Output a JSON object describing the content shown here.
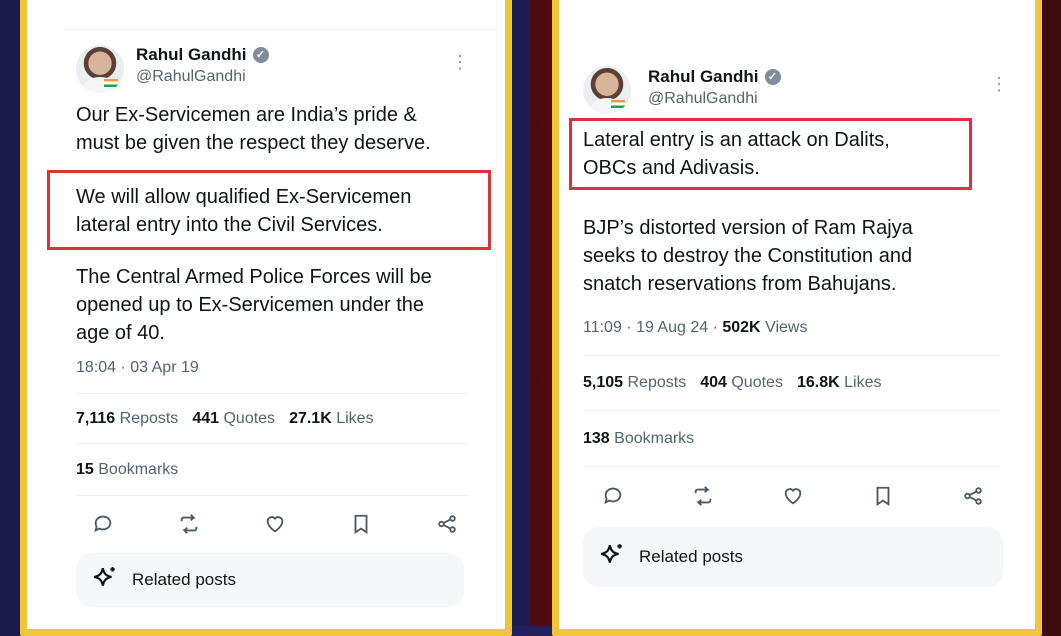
{
  "left_tweet": {
    "author_name": "Rahul Gandhi",
    "handle": "@RahulGandhi",
    "para1_line1": "Our Ex-Servicemen are India’s pride &",
    "para1_line2": "must be given the respect they deserve.",
    "highlight_line1": "We will allow qualified Ex-Servicemen",
    "highlight_line2": "lateral entry into the Civil Services.",
    "para3_line1": "The Central Armed Police Forces will be",
    "para3_line2": "opened up to Ex-Servicemen under the",
    "para3_line3": "age of 40.",
    "timestamp": "18:04 · 03 Apr 19",
    "reposts_count": "7,116",
    "reposts_label": "Reposts",
    "quotes_count": "441",
    "quotes_label": "Quotes",
    "likes_count": "27.1K",
    "likes_label": "Likes",
    "bookmarks_count": "15",
    "bookmarks_label": "Bookmarks",
    "related_label": "Related posts"
  },
  "right_tweet": {
    "author_name": "Rahul Gandhi",
    "handle": "@RahulGandhi",
    "highlight_line1": "Lateral entry is an attack on Dalits,",
    "highlight_line2": "OBCs and Adivasis.",
    "para2_line1": "BJP’s distorted version of Ram Rajya",
    "para2_line2": "seeks to destroy the Constitution and",
    "para2_line3": "snatch reservations from Bahujans.",
    "timestamp": "11:09 · 19 Aug 24 · ",
    "views_count": "502K",
    "views_label": "Views",
    "reposts_count": "5,105",
    "reposts_label": "Reposts",
    "quotes_count": "404",
    "quotes_label": "Quotes",
    "likes_count": "16.8K",
    "likes_label": "Likes",
    "bookmarks_count": "138",
    "bookmarks_label": "Bookmarks",
    "related_label": "Related posts"
  },
  "icons": [
    "reply-icon",
    "repost-icon",
    "like-icon",
    "bookmark-icon",
    "share-icon",
    "sparkle-icon",
    "verified-icon",
    "more-icon"
  ],
  "colors": {
    "frame": "#f0c53a",
    "highlight_border": "#e0303c",
    "left_background": "#232263",
    "right_background": "#6b1216"
  }
}
